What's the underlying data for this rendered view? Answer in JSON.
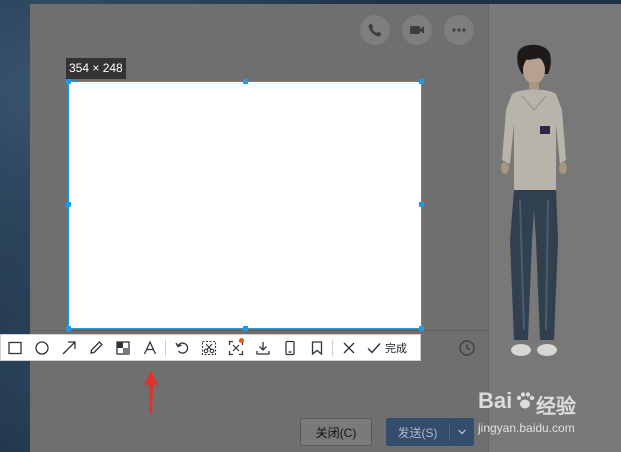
{
  "selection": {
    "size_label": "354 × 248"
  },
  "toolbar": {
    "tools": [
      {
        "name": "rectangle-tool",
        "icon": "rectangle-icon"
      },
      {
        "name": "ellipse-tool",
        "icon": "ellipse-icon"
      },
      {
        "name": "arrow-tool",
        "icon": "arrow-icon"
      },
      {
        "name": "pencil-tool",
        "icon": "pencil-icon"
      },
      {
        "name": "mosaic-tool",
        "icon": "mosaic-icon"
      },
      {
        "name": "text-tool",
        "icon": "text-icon"
      },
      {
        "name": "undo-tool",
        "icon": "undo-icon"
      },
      {
        "name": "cut-tool",
        "icon": "scissors-icon"
      },
      {
        "name": "screen-recognize-tool",
        "icon": "text-recognize-icon"
      },
      {
        "name": "download-tool",
        "icon": "download-icon"
      },
      {
        "name": "phone-tool",
        "icon": "phone-device-icon"
      },
      {
        "name": "pin-tool",
        "icon": "bookmark-icon"
      },
      {
        "name": "cancel-tool",
        "icon": "close-icon"
      }
    ],
    "done_label": "完成"
  },
  "chat": {
    "close_label": "关闭(C)",
    "send_label": "发送(S)"
  },
  "watermark": {
    "brand": "Bai",
    "brand_suffix": "经验",
    "url": "jingyan.baidu.com"
  },
  "colors": {
    "selection_border": "#1e9be5",
    "annotation_arrow": "#e5302a",
    "send_button": "#344d6d"
  }
}
